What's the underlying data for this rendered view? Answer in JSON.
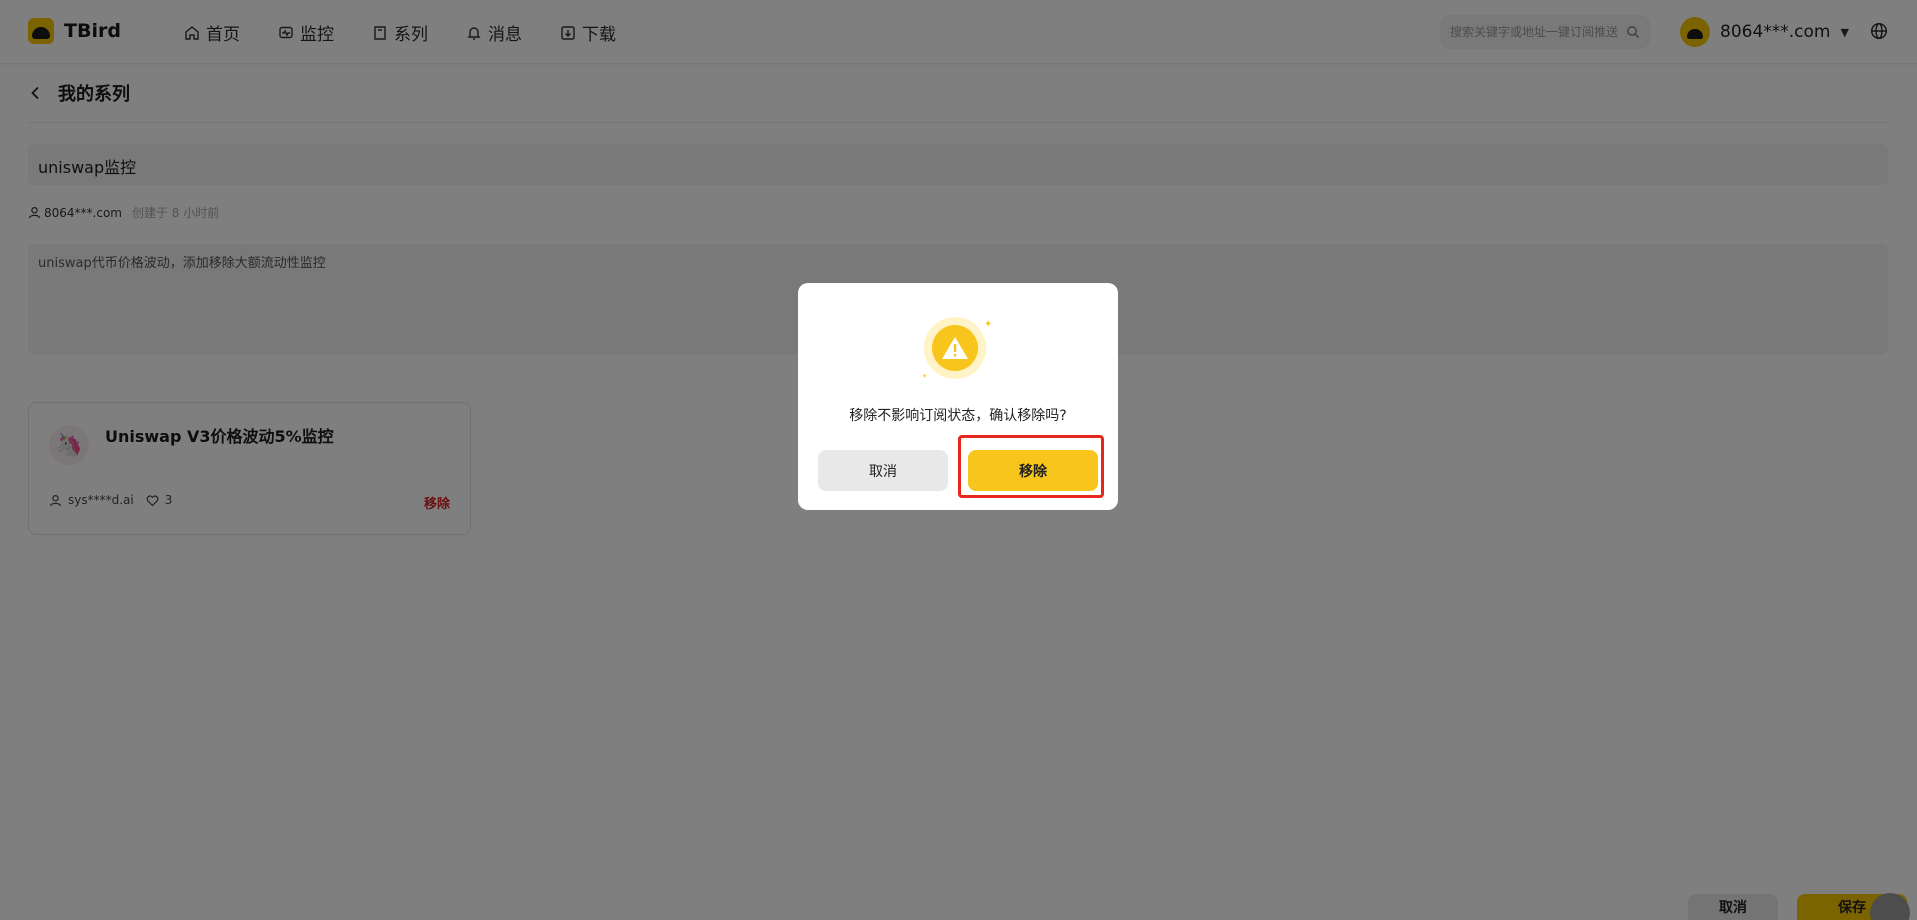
{
  "header": {
    "logo_text": "TBird",
    "nav": [
      {
        "label": "首页",
        "icon": "home-icon"
      },
      {
        "label": "监控",
        "icon": "monitor-icon"
      },
      {
        "label": "系列",
        "icon": "book-icon"
      },
      {
        "label": "消息",
        "icon": "bell-icon"
      },
      {
        "label": "下载",
        "icon": "download-icon"
      }
    ],
    "search_placeholder": "搜索关键字或地址一键订阅推送",
    "user_name": "8064***.com"
  },
  "page": {
    "title": "我的系列",
    "series_name": "uniswap监控",
    "owner": "8064***.com",
    "created_time": "创建于 8 小时前",
    "description": "uniswap代币价格波动，添加移除大额流动性监控"
  },
  "card": {
    "title": "Uniswap V3价格波动5%监控",
    "author": "sys****d.ai",
    "likes": "3",
    "remove_label": "移除"
  },
  "footer": {
    "cancel_label": "取消",
    "save_label": "保存"
  },
  "modal": {
    "message": "移除不影响订阅状态，确认移除吗?",
    "cancel_label": "取消",
    "confirm_label": "移除"
  },
  "colors": {
    "brand": "#f7c800",
    "danger": "#d42020",
    "highlight": "#e8261c"
  }
}
